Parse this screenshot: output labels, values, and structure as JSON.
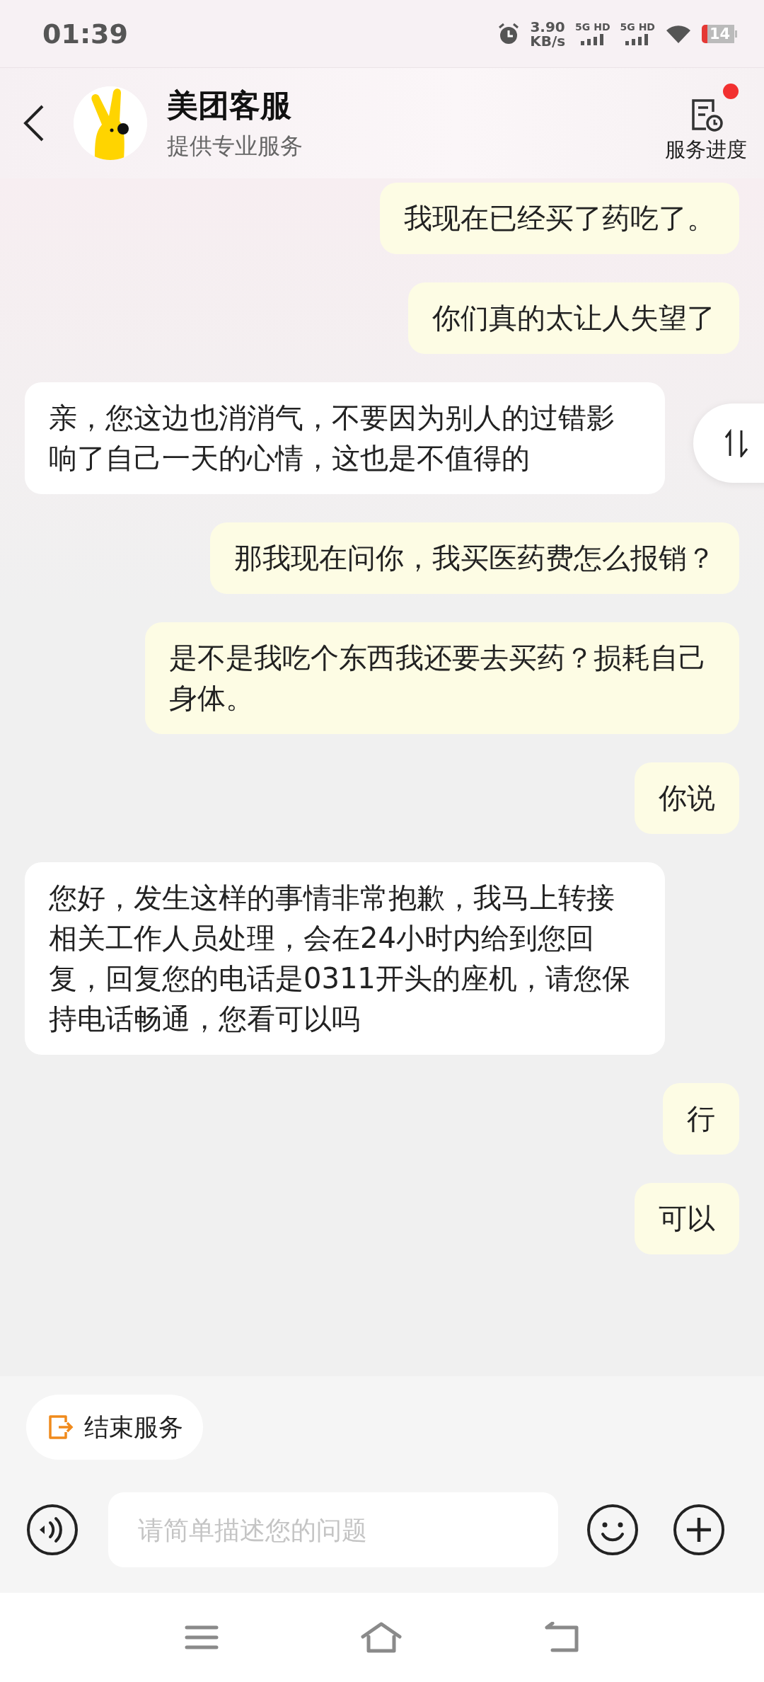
{
  "status_bar": {
    "time": "01:39",
    "net_speed": "3.90",
    "net_unit": "KB/s",
    "signals": [
      "5G HD",
      "5G HD"
    ],
    "battery": "14"
  },
  "header": {
    "title": "美团客服",
    "subtitle": "提供专业服务",
    "progress_label": "服务进度",
    "progress_notification": true
  },
  "messages": [
    {
      "kind": "user",
      "text": "我现在已经买了药吃了。"
    },
    {
      "kind": "user",
      "text": "你们真的太让人失望了"
    },
    {
      "kind": "agent",
      "text": "亲，您这边也消消气，不要因为别人的过错影响了自己一天的心情，这也是不值得的"
    },
    {
      "kind": "user",
      "text": "那我现在问你，我买医药费怎么报销？"
    },
    {
      "kind": "user",
      "text": "是不是我吃个东西我还要去买药？损耗自己身体。"
    },
    {
      "kind": "user",
      "text": "你说"
    },
    {
      "kind": "agent",
      "text": "您好，发生这样的事情非常抱歉，我马上转接相关工作人员处理，会在24小时内给到您回复，回复您的电话是0311开头的座机，请您保持电话畅通，您看可以吗"
    },
    {
      "kind": "user",
      "text": "行"
    },
    {
      "kind": "user",
      "text": "可以"
    }
  ],
  "end_service": "结束服务",
  "input": {
    "placeholder": "请简单描述您的问题"
  }
}
